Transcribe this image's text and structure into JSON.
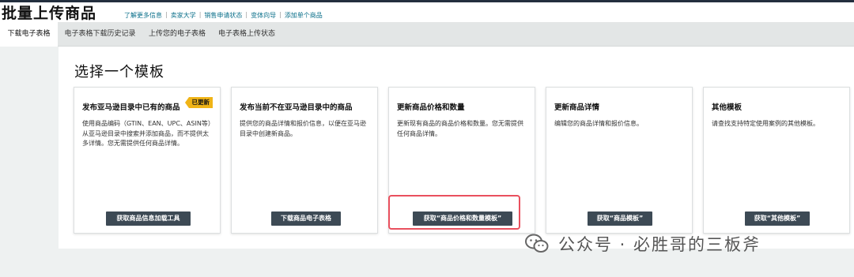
{
  "header": {
    "title": "批量上传商品",
    "links": [
      "了解更多信息",
      "卖家大学",
      "销售申请状态",
      "变体向导",
      "添加单个商品"
    ]
  },
  "tabs": [
    "下载电子表格",
    "电子表格下载历史记录",
    "上传您的电子表格",
    "电子表格上传状态"
  ],
  "section_title": "选择一个模板",
  "cards": [
    {
      "title": "发布亚马逊目录中已有的商品",
      "badge": "已更新",
      "description": "使用商品编码（GTIN、EAN、UPC、ASIN等）从亚马逊目录中搜索并添加商品，而不提供太多详情。您无需提供任何商品详情。",
      "button": "获取商品信息加载工具"
    },
    {
      "title": "发布当前不在亚马逊目录中的商品",
      "description": "提供您的商品详情和报价信息，以便在亚马逊目录中创建新商品。",
      "button": "下载商品电子表格"
    },
    {
      "title": "更新商品价格和数量",
      "description": "更新现有商品的商品价格和数量。您无需提供任何商品详情。",
      "button": "获取“商品价格和数量模板”"
    },
    {
      "title": "更新商品详情",
      "description": "编辑您的商品详情和报价信息。",
      "button": "获取“商品模板”"
    },
    {
      "title": "其他模板",
      "description": "请查找支持特定使用案例的其他模板。",
      "button": "获取“其他模板”"
    }
  ],
  "watermark": "公众号 · 必胜哥的三板斧",
  "colors": {
    "button": "#3d4a55",
    "badge": "#f0b417",
    "highlight": "#e9505e",
    "link": "#0a6f8a"
  }
}
